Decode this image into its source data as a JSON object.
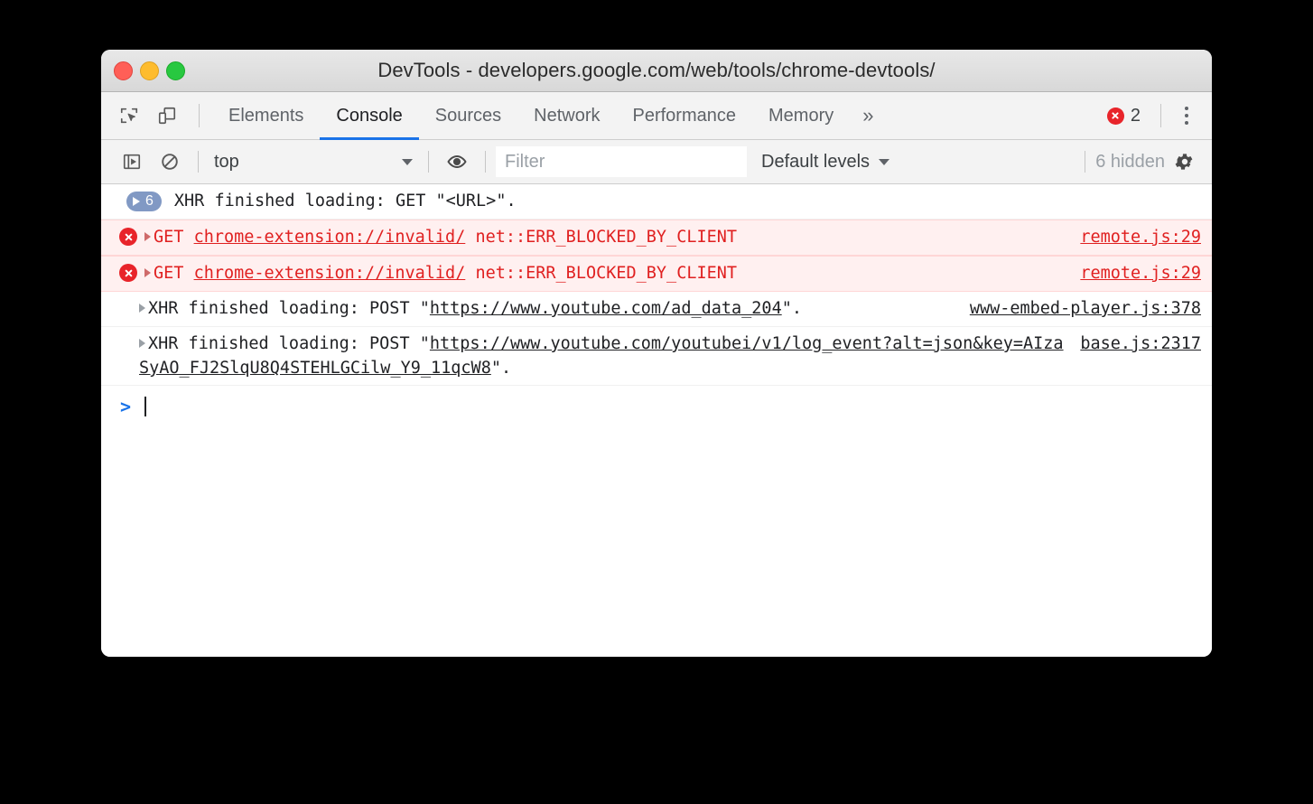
{
  "window": {
    "title": "DevTools - developers.google.com/web/tools/chrome-devtools/",
    "traffic_lights": {
      "close": "close-window",
      "minimize": "minimize-window",
      "maximize": "maximize-window"
    },
    "colors": {
      "close": "#ff5f57",
      "minimize": "#febc2e",
      "maximize": "#28c840",
      "accent": "#1a73e8",
      "error": "#e02020",
      "error_badge": "#e8242a",
      "error_row_bg": "#fff0f0",
      "group_pill": "#8199c4",
      "toolbar_bg": "#f3f3f3"
    }
  },
  "tabbar": {
    "icons": [
      {
        "name": "inspect-element-icon",
        "label": "Inspect element"
      },
      {
        "name": "device-toolbar-icon",
        "label": "Toggle device toolbar"
      }
    ],
    "tabs": [
      {
        "label": "Elements",
        "active": false
      },
      {
        "label": "Console",
        "active": true
      },
      {
        "label": "Sources",
        "active": false
      },
      {
        "label": "Network",
        "active": false
      },
      {
        "label": "Performance",
        "active": false
      },
      {
        "label": "Memory",
        "active": false
      }
    ],
    "overflow_label": "»",
    "error_count": "2",
    "error_icon": "error-circle-icon",
    "menu_label": "more-options"
  },
  "console_toolbar": {
    "sidebar_toggle": "show-console-sidebar-icon",
    "clear_console": "clear-console-icon",
    "context_value": "top",
    "context_caret": "chevron-down-icon",
    "live_expression": "eye-icon",
    "filter_placeholder": "Filter",
    "filter_value": "",
    "levels_label": "Default levels",
    "levels_caret": "chevron-down-icon",
    "hidden_label": "6 hidden",
    "settings_icon": "gear-icon"
  },
  "console_messages": [
    {
      "type": "group",
      "badge_count": "6",
      "text": "XHR finished loading: GET \"<URL>\".",
      "source": ""
    },
    {
      "type": "error",
      "method": "GET",
      "url": "chrome-extension://invalid/",
      "detail": "net::ERR_BLOCKED_BY_CLIENT",
      "source": "remote.js:29"
    },
    {
      "type": "error",
      "method": "GET",
      "url": "chrome-extension://invalid/",
      "detail": "net::ERR_BLOCKED_BY_CLIENT",
      "source": "remote.js:29"
    },
    {
      "type": "info",
      "prefix": "XHR finished loading: POST \"",
      "url": "https://www.youtube.com/ad_data_204",
      "suffix": "\".",
      "source": "www-embed-player.js:378"
    },
    {
      "type": "info",
      "prefix": "XHR finished loading: POST \"",
      "url": "https://www.youtube.com/youtubei/v1/log_event?alt=json&key=AIzaSyAO_FJ2SlqU8Q4STEHLGCilw_Y9_11qcW8",
      "suffix": "\".",
      "source": "base.js:2317"
    }
  ],
  "prompt": {
    "arrow": ">",
    "value": ""
  }
}
